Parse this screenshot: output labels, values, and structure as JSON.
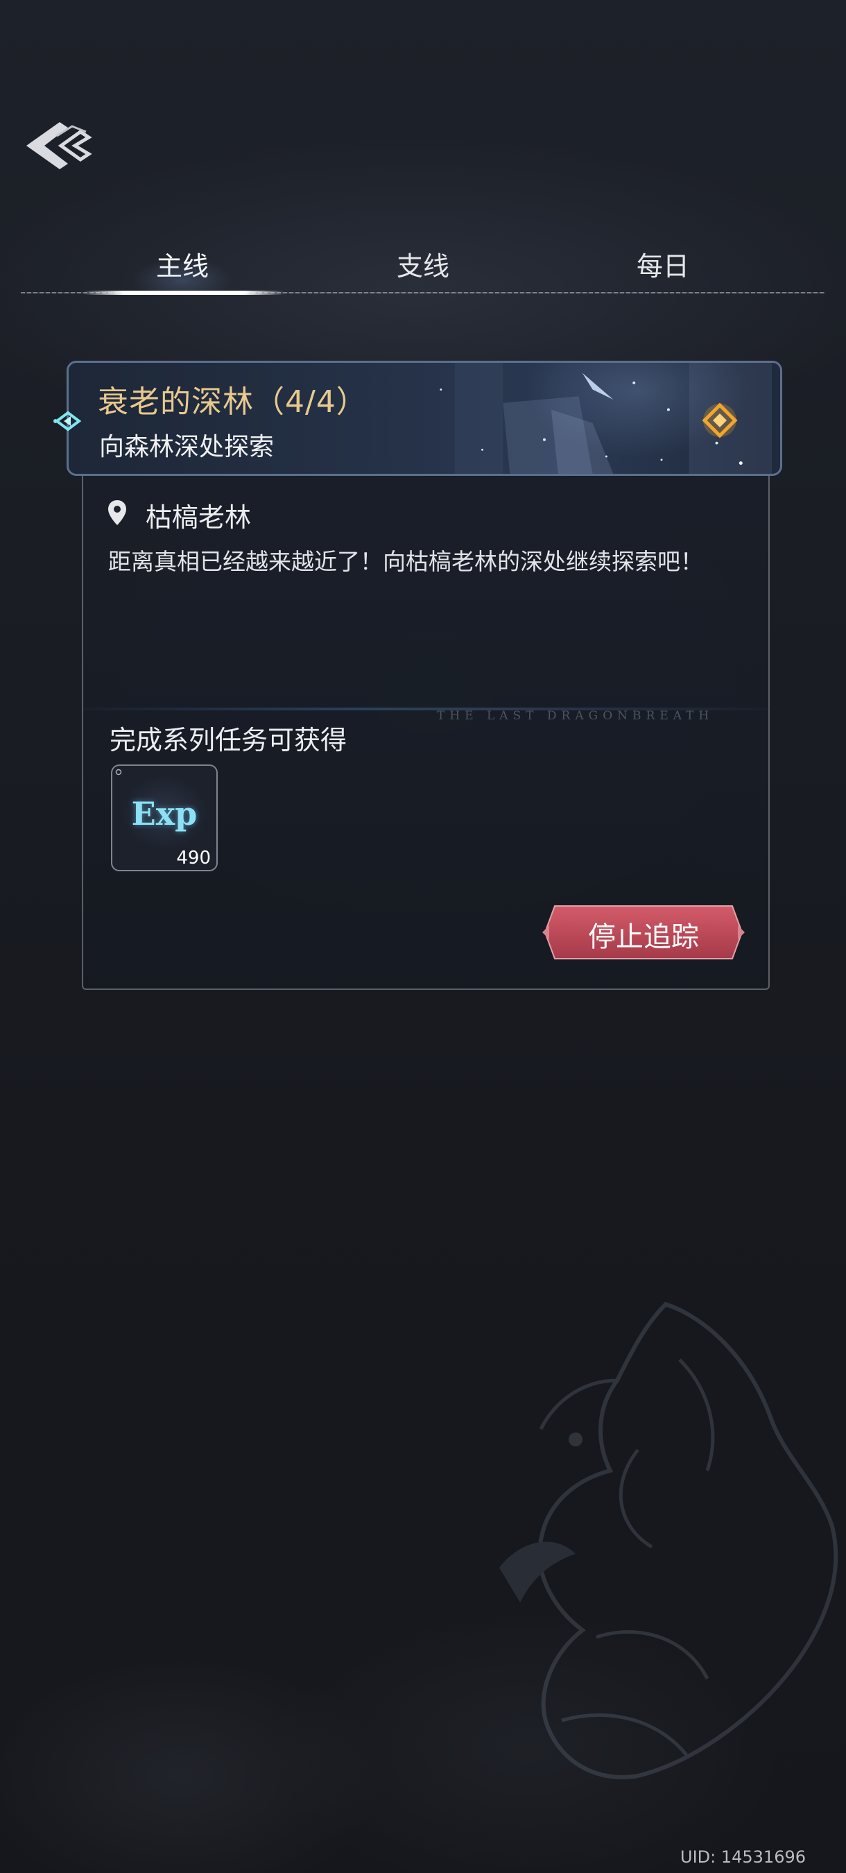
{
  "tabs": [
    {
      "label": "主线",
      "active": true
    },
    {
      "label": "支线",
      "active": false
    },
    {
      "label": "每日",
      "active": false
    }
  ],
  "quest": {
    "title": "衰老的深林（4/4）",
    "subtitle": "向森林深处探索",
    "location": "枯槁老林",
    "description": "距离真相已经越来越近了！向枯槁老林的深处继续探索吧！",
    "watermark": "THE LAST DRAGONBREATH",
    "reward_title": "完成系列任务可获得",
    "rewards": [
      {
        "icon": "exp-icon",
        "label": "Exp",
        "count": "490"
      }
    ],
    "stop_label": "停止追踪"
  },
  "footer": {
    "uid": "UID: 14531696"
  },
  "colors": {
    "title_gold": "#e8c98e",
    "exp_cyan": "#8fe0f4",
    "stop_red": "#c14d5c",
    "marker_orange": "#f2a62a"
  }
}
